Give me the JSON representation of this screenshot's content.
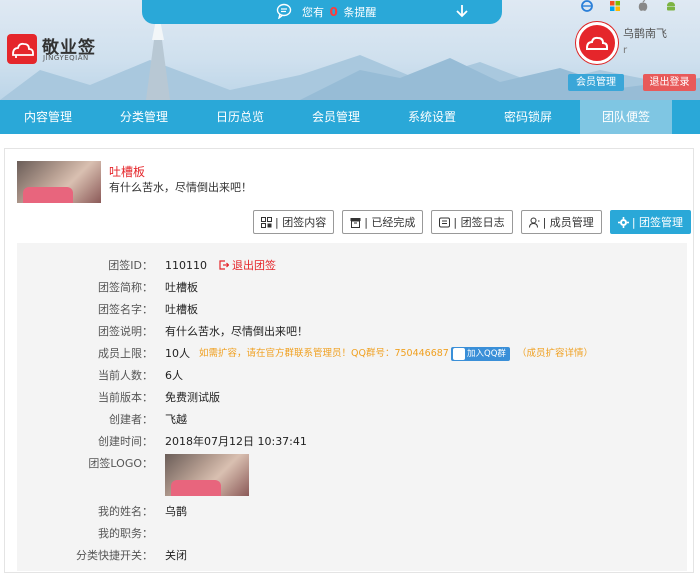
{
  "notice": {
    "prefix": "您有",
    "count": "0",
    "suffix": "条提醒"
  },
  "brand": {
    "name": "敬业签",
    "sub": "JINGYEQIAN"
  },
  "user": {
    "name": "乌鹊南飞",
    "line": "r",
    "member_btn": "会员管理",
    "logout_btn": "退出登录"
  },
  "os_icons": [
    "ie-icon",
    "windows-icon",
    "apple-icon",
    "android-icon"
  ],
  "nav": [
    "内容管理",
    "分类管理",
    "日历总览",
    "会员管理",
    "系统设置",
    "密码锁屏",
    "团队便签"
  ],
  "team": {
    "title": "吐槽板",
    "desc": "有什么苦水，尽情倒出来吧！"
  },
  "tabs": [
    "| 团签内容",
    "| 已经完成",
    "| 团签日志",
    "| 成员管理",
    "| 团签管理"
  ],
  "details": {
    "id_label": "团签ID：",
    "id_value": "110110",
    "exit_label": "退出团签",
    "short_label": "团签简称：",
    "short_value": "吐槽板",
    "name_label": "团签名字：",
    "name_value": "吐槽板",
    "desc_label": "团签说明：",
    "desc_value": "有什么苦水，尽情倒出来吧！",
    "limit_label": "成员上限：",
    "limit_value": "10人",
    "limit_hint": "如需扩容，请在官方群联系管理员！QQ群号：750446687",
    "qq_btn": "加入QQ群",
    "limit_hint2": "（成员扩容详情）",
    "count_label": "当前人数：",
    "count_value": "6人",
    "version_label": "当前版本：",
    "version_value": "免费测试版",
    "creator_label": "创建者：",
    "creator_value": "飞越",
    "time_label": "创建时间：",
    "time_value": "2018年07月12日 10:37:41",
    "logo_label": "团签LOGO：",
    "myname_label": "我的姓名：",
    "myname_value": "乌鹊",
    "myrole_label": "我的职务：",
    "myrole_value": "",
    "shortcut_label": "分类快捷开关：",
    "shortcut_value": "关闭"
  }
}
